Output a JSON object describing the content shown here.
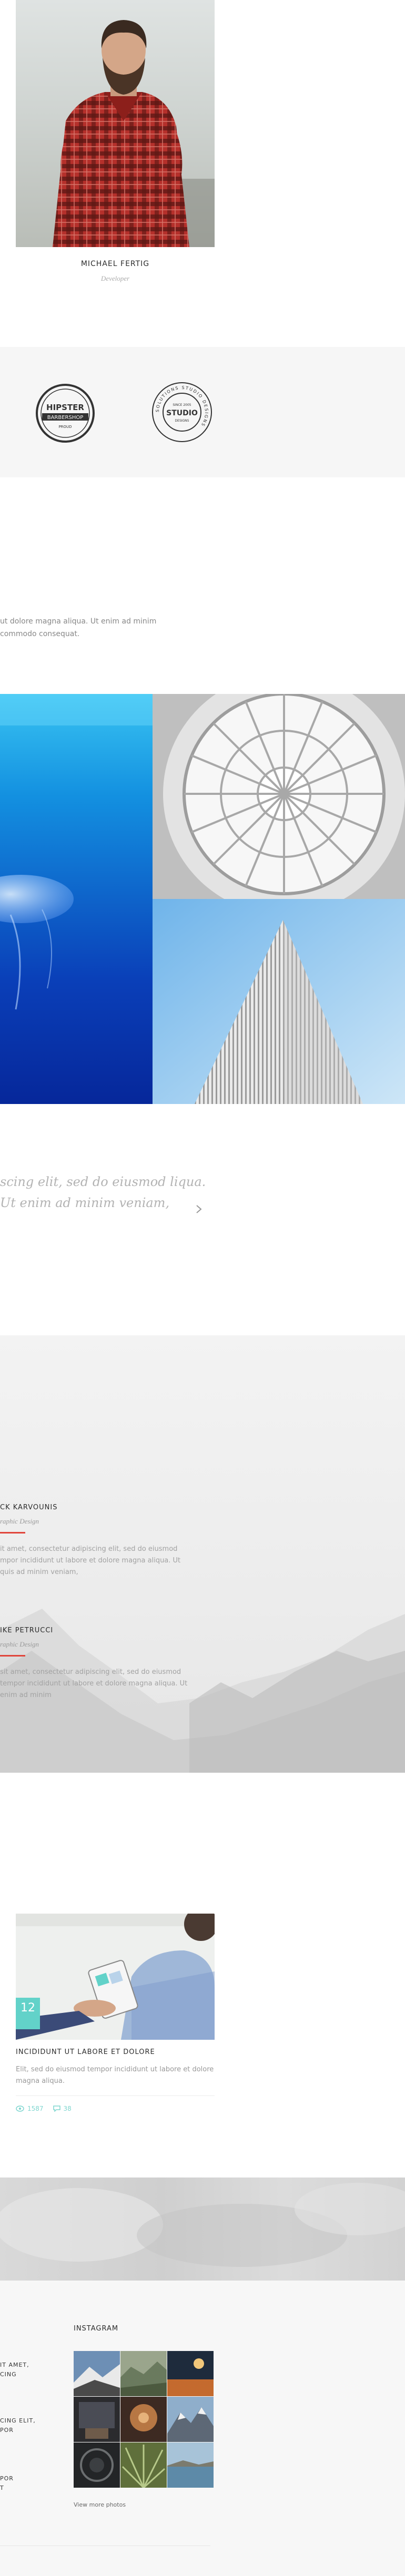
{
  "team": {
    "name": "MICHAEL FERTIG",
    "role": "Developer"
  },
  "logos": [
    {
      "name": "hipster-barbershop",
      "top_text": "HIPSTER",
      "middle_text": "BARBERSHOP",
      "bottom_text": "PROUD"
    },
    {
      "name": "studio-seal",
      "ring_text": "SOLUTIONS STUDIO DESIGNS",
      "top_text": "SINCE 2005",
      "middle_text": "STUDIO",
      "bottom_text": "DESIGNS"
    }
  ],
  "text_fragment": "ut dolore magna aliqua. Ut enim ad minim commodo consequat.",
  "quote": {
    "text": "scing elit, sed do eiusmod liqua. Ut enim ad minim veniam,",
    "next_icon": "chevron-right-icon"
  },
  "testimonials": [
    {
      "name": "CK KARVOUNIS",
      "role": "raphic Design",
      "text": "it amet, consectetur adipiscing elit, sed do eiusmod mpor incididunt ut labore et dolore magna aliqua. Ut quis ad minim veniam,"
    },
    {
      "name": "IKE PETRUCCI",
      "role": "raphic Design",
      "text": "sit amet, consectetur adipiscing elit, sed do eiusmod tempor incididunt ut labore et dolore magna aliqua. Ut enim ad minim"
    }
  ],
  "blog": {
    "date_day": "12",
    "title": "INCIDIDUNT UT LABORE ET DOLORE",
    "excerpt": "Elit, sed do eiusmod tempor incididunt ut labore et dolore magna aliqua.",
    "views": "1587",
    "comments": "38",
    "accent": "#62d2c9"
  },
  "footer": {
    "fragments": [
      "IT AMET,\nCING",
      "CING ELIT,\nPOR",
      "POR\nT"
    ],
    "instagram_heading": "INSTAGRAM",
    "view_more": "View more photos"
  },
  "colors": {
    "accent_red": "#e0453b",
    "accent_teal": "#62d2c9"
  }
}
